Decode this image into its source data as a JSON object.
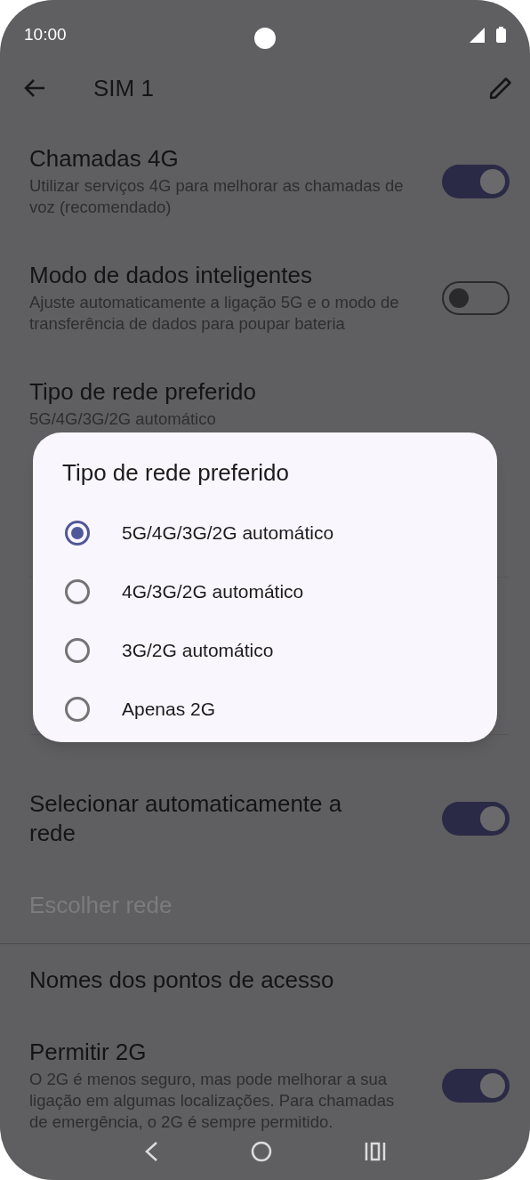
{
  "status_bar": {
    "time": "10:00"
  },
  "app_bar": {
    "title": "SIM 1"
  },
  "settings": [
    {
      "kind": "toggle",
      "title": "Chamadas 4G",
      "description": "Utilizar serviços 4G para melhorar as chamadas de voz (recomendado)",
      "on": true
    },
    {
      "kind": "toggle",
      "title": "Modo de dados inteligentes",
      "description": "Ajuste automaticamente a ligação 5G e o modo de transferência de dados para poupar bateria",
      "on": false
    },
    {
      "kind": "link",
      "title": "Tipo de rede preferido",
      "description": "5G/4G/3G/2G automático",
      "disabled": false
    },
    {
      "kind": "hidden"
    },
    {
      "kind": "toggle",
      "title": "Selecionar automaticamente a rede",
      "on": true
    },
    {
      "kind": "link",
      "title": "Escolher rede",
      "disabled": true
    },
    {
      "kind": "divider"
    },
    {
      "kind": "link",
      "title": "Nomes dos pontos de acesso",
      "disabled": false
    },
    {
      "kind": "toggle",
      "title": "Permitir 2G",
      "description": "O 2G é menos seguro, mas pode melhorar a sua ligação em algumas localizações. Para chamadas de emergência, o 2G é sempre permitido.",
      "on": true
    }
  ],
  "dialog": {
    "title": "Tipo de rede preferido",
    "options": [
      {
        "label": "5G/4G/3G/2G automático",
        "selected": true
      },
      {
        "label": "4G/3G/2G automático",
        "selected": false
      },
      {
        "label": "3G/2G automático",
        "selected": false
      },
      {
        "label": "Apenas 2G",
        "selected": false
      }
    ]
  }
}
